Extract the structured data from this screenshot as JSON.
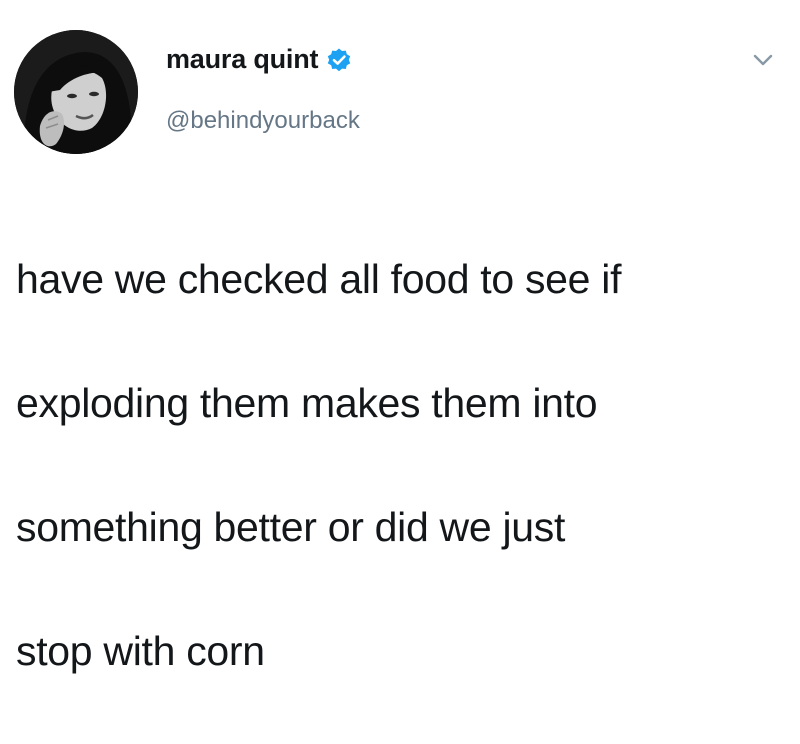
{
  "author": {
    "display_name": "maura quint",
    "handle": "@behindyourback",
    "verified": true
  },
  "tweet": {
    "lines": [
      "have we checked all food to see if",
      "exploding them makes them into",
      "something better or did we just",
      "stop with corn"
    ]
  },
  "icons": {
    "avatar": "avatar",
    "verified": "verified-badge-icon",
    "menu": "chevron-down-icon"
  },
  "colors": {
    "verified_blue": "#1da1f2",
    "handle_gray": "#657786",
    "text": "#14171a"
  }
}
